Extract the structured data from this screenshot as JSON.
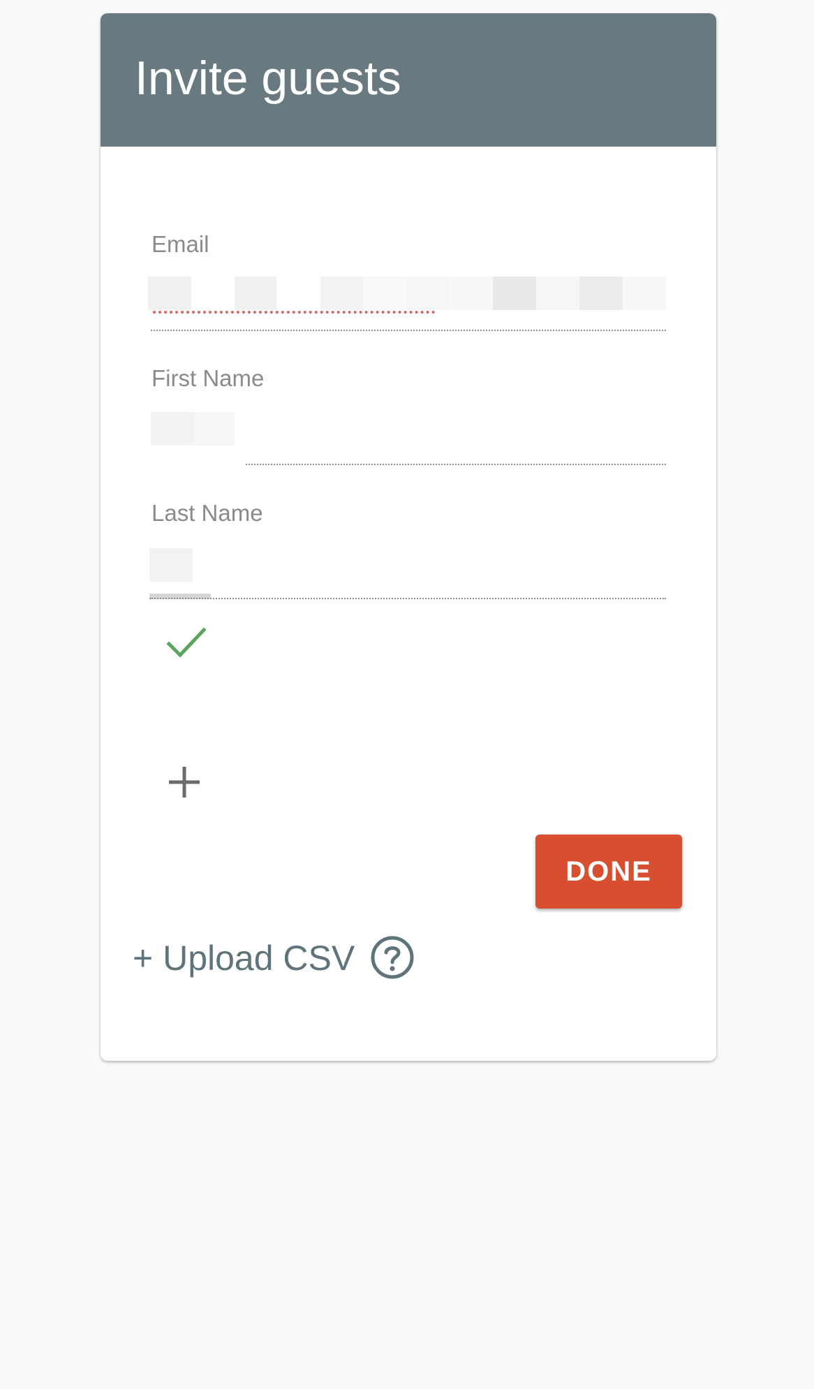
{
  "dialog": {
    "title": "Invite guests"
  },
  "form": {
    "email": {
      "label": "Email",
      "value": ""
    },
    "first_name": {
      "label": "First Name",
      "value": ""
    },
    "last_name": {
      "label": "Last Name",
      "value": ""
    }
  },
  "actions": {
    "done_label": "DONE",
    "upload_label": "+ Upload CSV"
  },
  "icons": {
    "check": "check-icon",
    "add": "plus-icon",
    "help": "help-circle-icon"
  },
  "colors": {
    "header": "#68797f",
    "done_button": "#d84f30",
    "check": "#5aa45c",
    "link": "#5f737a"
  }
}
